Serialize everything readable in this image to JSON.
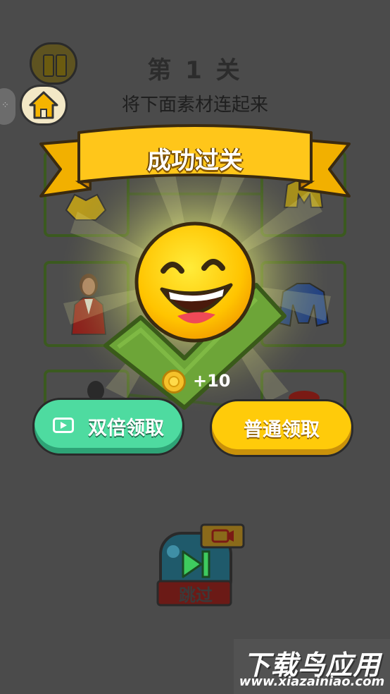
{
  "header": {
    "level_title": "第 1 关",
    "subtitle": "将下面素材连起来"
  },
  "banner": {
    "text": "成功过关"
  },
  "reward": {
    "coin_amount": "+10"
  },
  "buttons": {
    "double_claim": "双倍领取",
    "normal_claim": "普通领取",
    "skip": "跳过"
  },
  "icons": {
    "pause": "pause-icon",
    "home": "home-icon",
    "menu": "menu-dots-icon",
    "video": "video-icon",
    "coin": "coin-icon",
    "skip": "skip-icon"
  },
  "watermark": {
    "title": "下载鸟应用",
    "url": "www.xiazainiao.com"
  },
  "colors": {
    "overlay": "#4b4b4b",
    "green_button": "#4edba0",
    "yellow_button": "#ffcb0a",
    "banner": "#ffc61a",
    "check": "#6da538"
  }
}
